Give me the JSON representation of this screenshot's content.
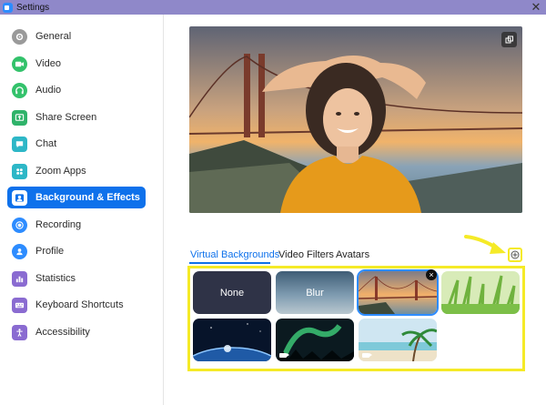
{
  "window": {
    "title": "Settings",
    "close_glyph": "✕"
  },
  "sidebar": {
    "items": [
      {
        "label": "General",
        "icon": "gear-icon",
        "color": "#8f8f8f"
      },
      {
        "label": "Video",
        "icon": "video-camera-icon",
        "color": "#33c26b"
      },
      {
        "label": "Audio",
        "icon": "headphones-icon",
        "color": "#33c26b"
      },
      {
        "label": "Share Screen",
        "icon": "share-screen-icon",
        "color": "#2fb36a"
      },
      {
        "label": "Chat",
        "icon": "chat-bubble-icon",
        "color": "#2db7c7"
      },
      {
        "label": "Zoom Apps",
        "icon": "apps-icon",
        "color": "#2db7c7"
      },
      {
        "label": "Background & Effects",
        "icon": "person-portrait-icon",
        "color": "#0e71eb",
        "active": true
      },
      {
        "label": "Recording",
        "icon": "record-icon",
        "color": "#2d8cff"
      },
      {
        "label": "Profile",
        "icon": "profile-icon",
        "color": "#2d8cff"
      },
      {
        "label": "Statistics",
        "icon": "bar-chart-icon",
        "color": "#8a6bd1"
      },
      {
        "label": "Keyboard Shortcuts",
        "icon": "keyboard-icon",
        "color": "#8a6bd1"
      },
      {
        "label": "Accessibility",
        "icon": "accessibility-icon",
        "color": "#8a6bd1"
      }
    ]
  },
  "tabs": [
    {
      "label": "Virtual Backgrounds",
      "active": true
    },
    {
      "label": "Video Filters"
    },
    {
      "label": "Avatars"
    }
  ],
  "backgrounds": [
    {
      "label": "None",
      "kind": "none"
    },
    {
      "label": "Blur",
      "kind": "blur"
    },
    {
      "label": "",
      "kind": "golden-gate",
      "selected": true
    },
    {
      "label": "",
      "kind": "grass"
    },
    {
      "label": "",
      "kind": "earth"
    },
    {
      "label": "",
      "kind": "aurora",
      "video": true
    },
    {
      "label": "",
      "kind": "beach",
      "video": true
    }
  ],
  "colors": {
    "accent": "#0e71eb",
    "highlight": "#f5ea27",
    "titlebar": "#8f88c9"
  }
}
